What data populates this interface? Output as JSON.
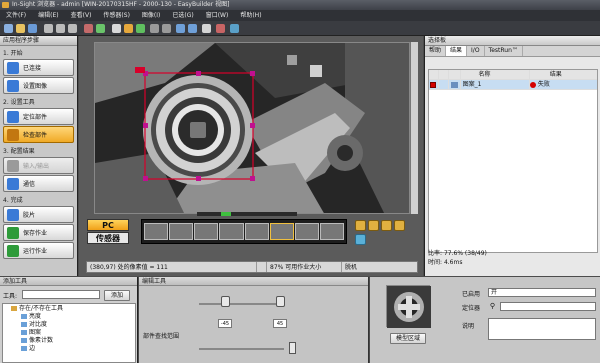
{
  "window": {
    "title": "In-Sight 浏览器 - admin [WIN-20170315HF - 2000-130 - EasyBuilder 视图]"
  },
  "menu": [
    "文件(F)",
    "编辑(E)",
    "查看(V)",
    "传感器(S)",
    "图像(I)",
    "已选(G)",
    "窗口(W)",
    "帮助(H)"
  ],
  "left_pane": {
    "title": "应用程序步骤",
    "sections": [
      {
        "label": "1. 开始",
        "items": [
          {
            "label": "已连接",
            "state": "normal",
            "icon_color": "#3a7ad6"
          },
          {
            "label": "设置图像",
            "state": "normal",
            "icon_color": "#3a7ad6"
          }
        ]
      },
      {
        "label": "2. 设置工具",
        "items": [
          {
            "label": "定位部件",
            "state": "normal",
            "icon_color": "#3a7ad6"
          },
          {
            "label": "检查部件",
            "state": "active",
            "icon_color": "#c27710"
          }
        ]
      },
      {
        "label": "3. 配置结果",
        "items": [
          {
            "label": "输入/输出",
            "state": "disabled",
            "icon_color": "#9a9a9a"
          },
          {
            "label": "通信",
            "state": "normal",
            "icon_color": "#3a7ad6"
          }
        ]
      },
      {
        "label": "4. 完成",
        "items": [
          {
            "label": "胶片",
            "state": "normal",
            "icon_color": "#3a7ad6"
          },
          {
            "label": "保存作业",
            "state": "normal",
            "icon_color": "#2e9b3a"
          },
          {
            "label": "运行作业",
            "state": "normal",
            "icon_color": "#2e9b3a"
          }
        ]
      }
    ]
  },
  "center": {
    "pc_label": "PC",
    "sensor_label": "传感器",
    "status": [
      "(380,97) 处的像素值 = 111",
      "87% 可用作业大小",
      "脱机"
    ]
  },
  "right_pane": {
    "title": "选择板",
    "tabs": [
      "帮助",
      "结果",
      "I/O",
      "TestRun™"
    ],
    "selected_tab": "结果",
    "columns": [
      "名称",
      "结果"
    ],
    "rows": [
      {
        "name": "图案_1",
        "result": "失败"
      }
    ],
    "ratio_label": "比率:",
    "ratio_value": "77.6% (38/49)",
    "time_label": "时间:",
    "time_value": "4.6ms"
  },
  "bottom_left": {
    "title": "添加工具",
    "tool_label": "工具:",
    "add_button": "添加",
    "tree": [
      {
        "label": "存在/不存在工具",
        "level": 0
      },
      {
        "label": "亮度",
        "level": 1
      },
      {
        "label": "对比度",
        "level": 1
      },
      {
        "label": "图案",
        "level": 1
      },
      {
        "label": "像素计数",
        "level": 1
      },
      {
        "label": "边",
        "level": 1
      }
    ]
  },
  "bottom_mid": {
    "title": "编辑工具",
    "angle_min": "-45",
    "angle_max": "45",
    "section2": "部件查找范围"
  },
  "bottom_right": {
    "model_button": "模型区域",
    "enabled_label": "已启用",
    "enabled_value": "开",
    "locator_label": "定位器",
    "comment_label": "说明"
  },
  "colors": {
    "accent": "#f0a926",
    "roi": "#d8002a",
    "fail": "#d40000"
  }
}
